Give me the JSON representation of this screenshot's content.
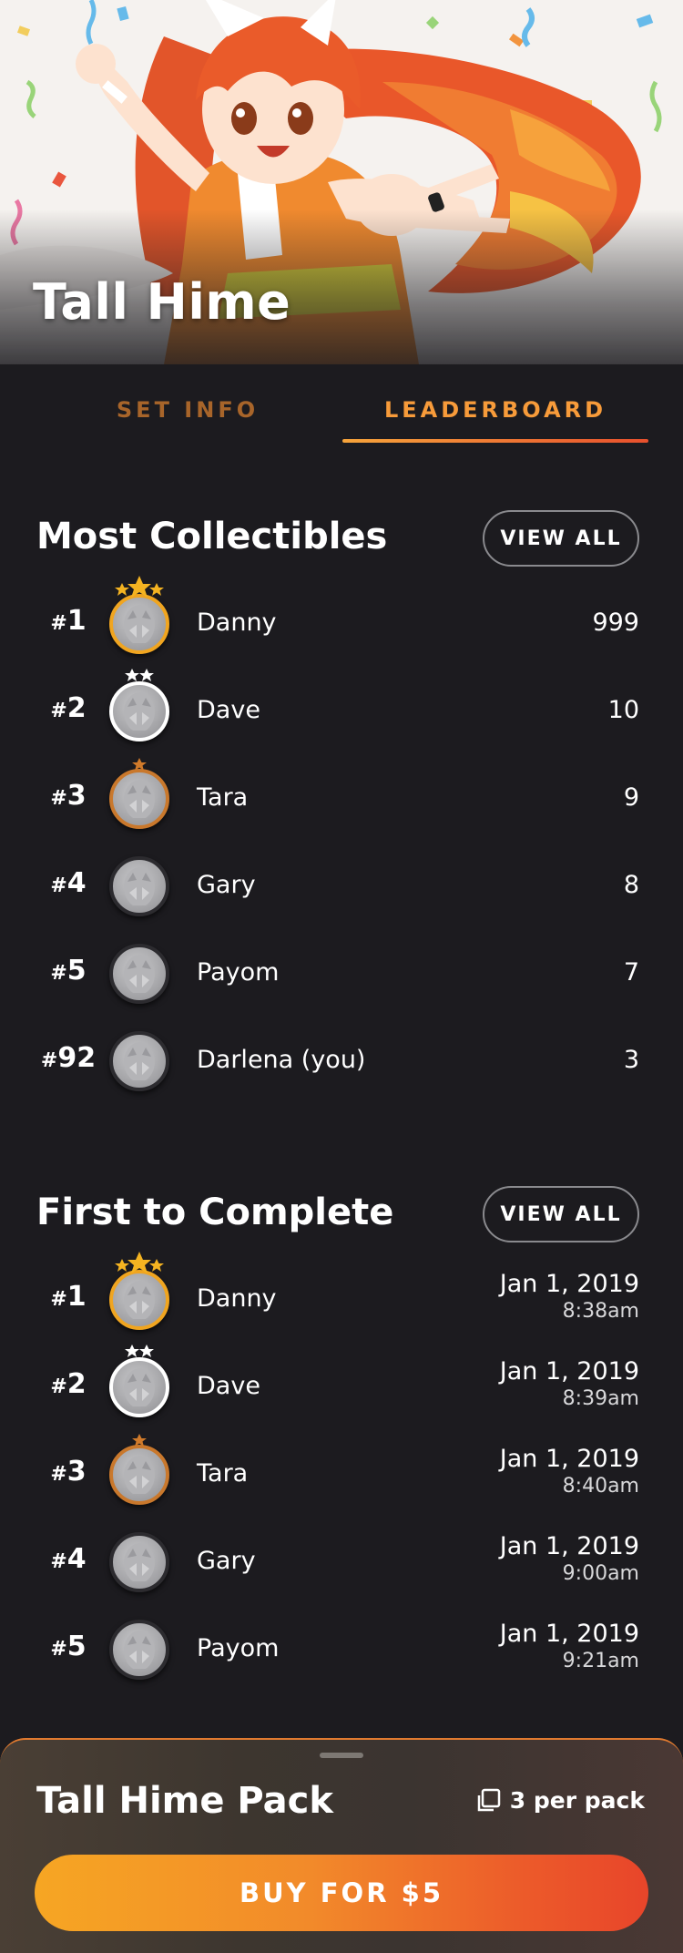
{
  "hero": {
    "title": "Tall Hime",
    "image": "anime-character-celebration-illustration"
  },
  "tabs": [
    {
      "label": "SET INFO",
      "active": false
    },
    {
      "label": "LEADERBOARD",
      "active": true
    }
  ],
  "most_collectibles": {
    "title": "Most Collectibles",
    "view_all_label": "VIEW ALL",
    "rows": [
      {
        "rank_hash": "#",
        "rank": "1",
        "name": "Danny",
        "value": "999",
        "medal": "gold"
      },
      {
        "rank_hash": "#",
        "rank": "2",
        "name": "Dave",
        "value": "10",
        "medal": "silver"
      },
      {
        "rank_hash": "#",
        "rank": "3",
        "name": "Tara",
        "value": "9",
        "medal": "bronze"
      },
      {
        "rank_hash": "#",
        "rank": "4",
        "name": "Gary",
        "value": "8",
        "medal": "none"
      },
      {
        "rank_hash": "#",
        "rank": "5",
        "name": "Payom",
        "value": "7",
        "medal": "none"
      },
      {
        "rank_hash": "#",
        "rank": "92",
        "name": "Darlena (you)",
        "value": "3",
        "medal": "none"
      }
    ]
  },
  "first_to_complete": {
    "title": "First to Complete",
    "view_all_label": "VIEW ALL",
    "rows": [
      {
        "rank_hash": "#",
        "rank": "1",
        "name": "Danny",
        "date": "Jan 1, 2019",
        "time": "8:38am",
        "medal": "gold"
      },
      {
        "rank_hash": "#",
        "rank": "2",
        "name": "Dave",
        "date": "Jan 1, 2019",
        "time": "8:39am",
        "medal": "silver"
      },
      {
        "rank_hash": "#",
        "rank": "3",
        "name": "Tara",
        "date": "Jan 1, 2019",
        "time": "8:40am",
        "medal": "bronze"
      },
      {
        "rank_hash": "#",
        "rank": "4",
        "name": "Gary",
        "date": "Jan 1, 2019",
        "time": "9:00am",
        "medal": "none"
      },
      {
        "rank_hash": "#",
        "rank": "5",
        "name": "Payom",
        "date": "Jan 1, 2019",
        "time": "9:21am",
        "medal": "none"
      }
    ]
  },
  "pack_sheet": {
    "title": "Tall Hime Pack",
    "per_pack": "3 per pack",
    "per_pack_icon": "cards-stack-icon",
    "buy_label": "BUY FOR $5"
  },
  "colors": {
    "background": "#1c1b1f",
    "accent_orange": "#f79b3a",
    "accent_red": "#e8452a",
    "gold": "#f0a520",
    "silver": "#ffffff",
    "bronze": "#c9782c"
  }
}
